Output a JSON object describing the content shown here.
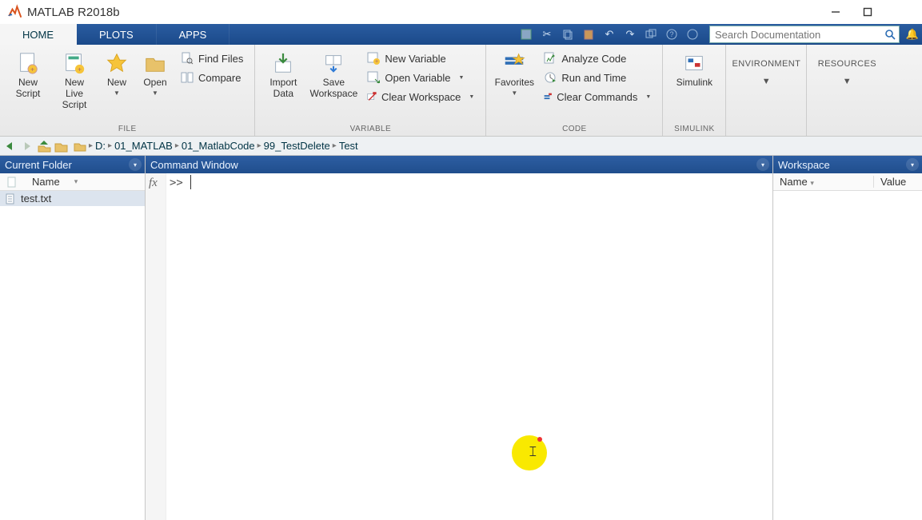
{
  "title": "MATLAB R2018b",
  "tabs": {
    "home": "HOME",
    "plots": "PLOTS",
    "apps": "APPS"
  },
  "search_placeholder": "Search Documentation",
  "ribbon": {
    "file": {
      "caption": "FILE",
      "new_script": "New\nScript",
      "new_live_script": "New\nLive Script",
      "new": "New",
      "open": "Open",
      "find_files": "Find Files",
      "compare": "Compare"
    },
    "variable": {
      "caption": "VARIABLE",
      "import": "Import\nData",
      "save_ws": "Save\nWorkspace",
      "new_var": "New Variable",
      "open_var": "Open Variable",
      "clear_ws": "Clear Workspace"
    },
    "code": {
      "caption": "CODE",
      "favorites": "Favorites",
      "analyze": "Analyze Code",
      "runtime": "Run and Time",
      "clear_cmd": "Clear Commands"
    },
    "simulink": {
      "caption": "SIMULINK",
      "label": "Simulink"
    },
    "environment": "ENVIRONMENT",
    "resources": "RESOURCES"
  },
  "breadcrumbs": [
    "D:",
    "01_MATLAB",
    "01_MatlabCode",
    "99_TestDelete",
    "Test"
  ],
  "panels": {
    "current_folder": "Current Folder",
    "command_window": "Command Window",
    "workspace": "Workspace"
  },
  "curfolder_cols": {
    "name": "Name"
  },
  "files": [
    {
      "name": "test.txt"
    }
  ],
  "workspace_cols": {
    "name": "Name",
    "value": "Value"
  },
  "prompt": ">>"
}
